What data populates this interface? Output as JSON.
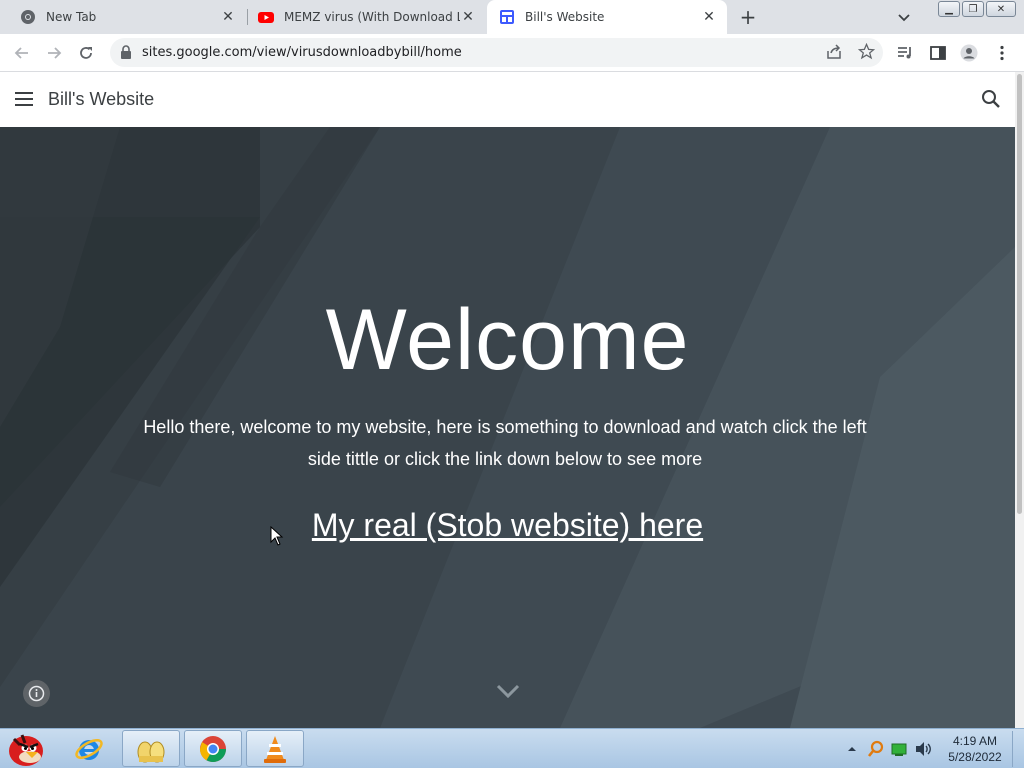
{
  "browser": {
    "tabs": [
      {
        "title": "New Tab",
        "icon": "chrome-icon",
        "active": false
      },
      {
        "title": "MEMZ virus (With Download Link",
        "icon": "youtube-icon",
        "active": false
      },
      {
        "title": "Bill's Website",
        "icon": "google-sites-icon",
        "active": true
      }
    ],
    "close_glyph": "✕",
    "new_tab_glyph": "+",
    "url": "sites.google.com/view/virusdownloadbybill/home",
    "window_buttons": {
      "minimize": "▁",
      "restore": "❐",
      "close": "✕"
    }
  },
  "site": {
    "title": "Bill's Website",
    "hero": {
      "heading": "Welcome",
      "intro": "Hello there, welcome to my website, here is something to download and watch click the left side tittle or click the link down below to see more",
      "link": "My real (Stob website) here"
    },
    "colors": {
      "hero_bg": "#363f45",
      "header_bg": "#ffffff"
    }
  },
  "taskbar": {
    "apps": [
      "angry-birds-start-icon",
      "internet-explorer-icon",
      "file-explorer-icon",
      "chrome-icon",
      "vlc-icon"
    ],
    "clock_time": "4:19 AM",
    "clock_date": "5/28/2022"
  }
}
